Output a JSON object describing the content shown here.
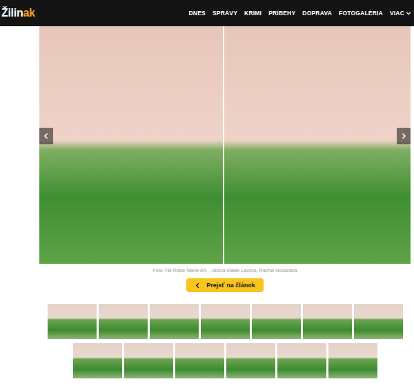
{
  "logo": {
    "main": "Žilin",
    "accent": "ak"
  },
  "nav": {
    "items": [
      {
        "label": "DNES"
      },
      {
        "label": "SPRÁVY"
      },
      {
        "label": "KRIMI"
      },
      {
        "label": "PRÍBEHY"
      },
      {
        "label": "DOPRAVA"
      },
      {
        "label": "FOTOGALÉRIA"
      }
    ],
    "more": "VIAC"
  },
  "gallery": {
    "photos": [
      {
        "kind": "photo"
      },
      {
        "kind": "photo"
      }
    ],
    "caption": "Foto: FB Rosie Naive Art, , Janica Malek Lacova, Rachel Novanská",
    "back_button": "Prejsť na článok"
  },
  "thumbnail_rows": [
    [
      {
        "kind": "photo"
      },
      {
        "kind": "photo"
      },
      {
        "kind": "photo"
      },
      {
        "kind": "photo"
      },
      {
        "kind": "photo"
      },
      {
        "kind": "photo"
      },
      {
        "kind": "photo"
      }
    ],
    [
      {
        "kind": "photo"
      },
      {
        "kind": "photo"
      },
      {
        "kind": "photo"
      },
      {
        "kind": "photo"
      },
      {
        "kind": "photo"
      },
      {
        "kind": "photo"
      }
    ]
  ]
}
